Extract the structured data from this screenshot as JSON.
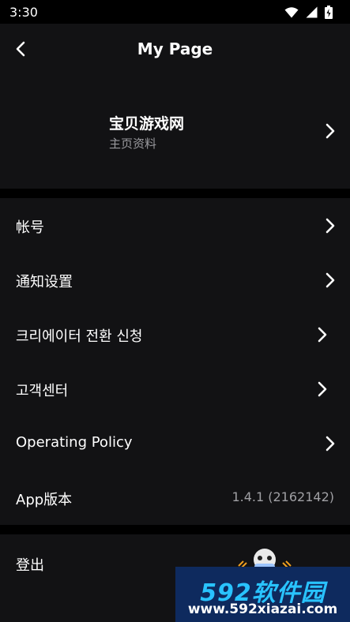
{
  "status_bar": {
    "time": "3:30"
  },
  "header": {
    "title": "My Page"
  },
  "profile": {
    "name": "宝贝游戏网",
    "subtitle": "主页资料"
  },
  "menu": {
    "items": [
      {
        "label": "帐号"
      },
      {
        "label": "通知设置"
      },
      {
        "label": "크리에이터 전환 신청"
      },
      {
        "label": "고객센터"
      },
      {
        "label": "Operating Policy"
      },
      {
        "label": "App版本",
        "value": "1.4.1 (2162142)"
      }
    ]
  },
  "logout": {
    "label": "登出"
  },
  "watermark": {
    "brand": "592软件园",
    "url": "www.592xiazai.com"
  },
  "colors": {
    "background": "#000000",
    "surface": "#121214",
    "secondary_text": "#9a9a9e",
    "watermark_bg": "#0e2a5e",
    "watermark_accent": "#29c3ff"
  },
  "icons": [
    "wifi-icon",
    "signal-icon",
    "battery-icon",
    "back-arrow-icon",
    "chevron-right-icon"
  ]
}
